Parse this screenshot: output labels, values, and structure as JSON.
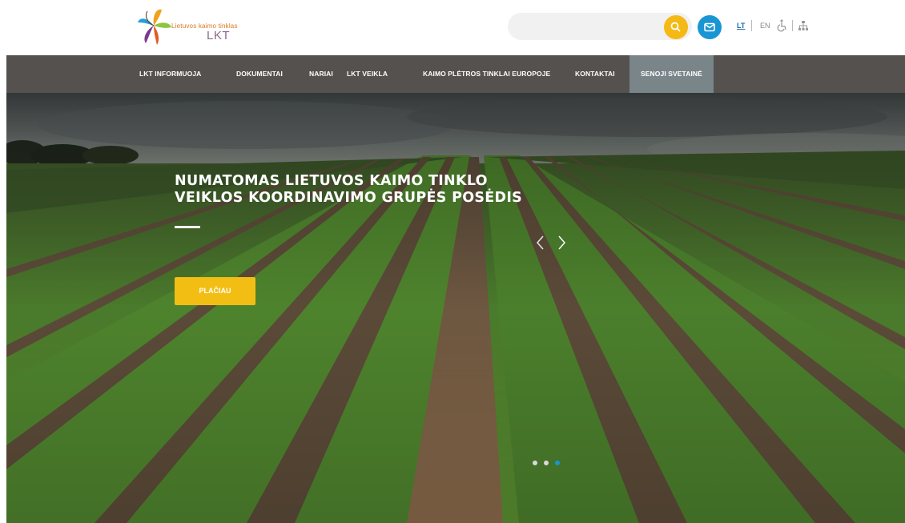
{
  "header": {
    "logo_small": "Lietuvos kaimo tinklas",
    "logo_big": "LKT",
    "search": {
      "value": "",
      "placeholder": ""
    },
    "languages": [
      "LT",
      "EN"
    ]
  },
  "nav": {
    "items": [
      "LKT INFORMUOJA",
      "DOKUMENTAI",
      "NARIAI",
      "LKT VEIKLA",
      "KAIMO PLĖTROS TINKLAI EUROPOJE",
      "KONTAKTAI",
      "SENOJI SVETAINĖ"
    ],
    "active_index": 6
  },
  "hero": {
    "title_line1": "NUMATOMAS LIETUVOS KAIMO TINKLO",
    "title_line2": "VEIKLOS KOORDINAVIMO GRUPĖS POSĖDIS",
    "button_label": "PLAČIAU",
    "slide_count": 3,
    "active_slide": 3
  },
  "colors": {
    "accent_yellow": "#f3be14",
    "accent_blue": "#1a95d4",
    "nav_bg": "#54514f",
    "nav_active_bg": "#7a8589"
  },
  "icons": {
    "search": "magnifier-icon",
    "mail": "envelope-icon",
    "accessibility": "wheelchair-icon",
    "sitemap": "sitemap-icon",
    "prev": "chevron-left-icon",
    "next": "chevron-right-icon"
  }
}
